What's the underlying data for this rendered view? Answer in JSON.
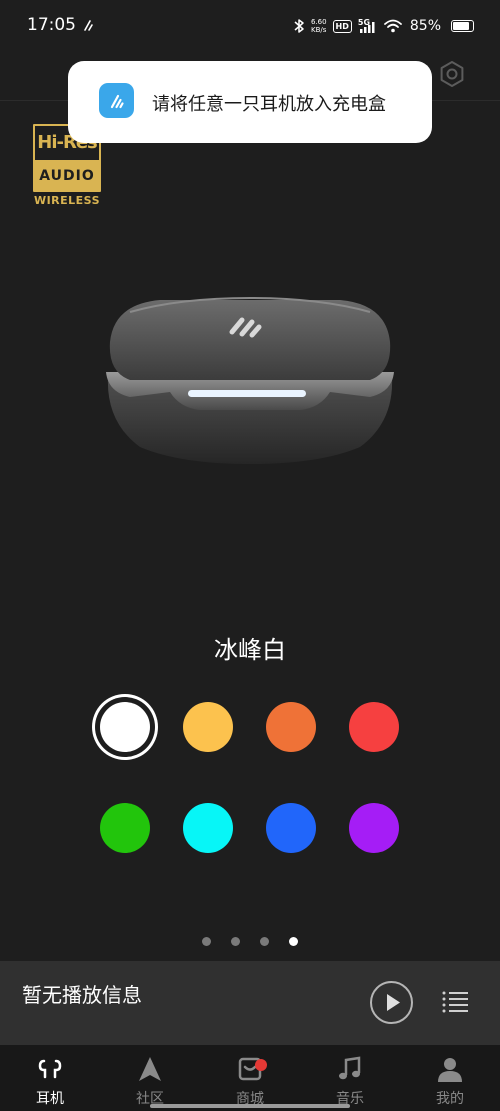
{
  "status_bar": {
    "time": "17:05",
    "speed_value": "6.60",
    "speed_unit": "KB/s",
    "hd_label": "HD",
    "network_label": "5G",
    "battery": "85%",
    "battery_level": 0.85
  },
  "notification": {
    "text": "请将任意一只耳机放入充电盒",
    "icon": "edifier-app-icon"
  },
  "logo": {
    "hires_text": "Hi-Res",
    "audio_text": "AUDIO",
    "wireless_text": "WIRELESS"
  },
  "product": {
    "image": "earbuds-charging-case",
    "color_name": "冰峰白"
  },
  "swatches": [
    {
      "color": "#ffffff",
      "selected": true
    },
    {
      "color": "#fcc24e",
      "selected": false
    },
    {
      "color": "#ef7237",
      "selected": false
    },
    {
      "color": "#f64040",
      "selected": false
    },
    {
      "color": "#22c50c",
      "selected": false
    },
    {
      "color": "#07f6f7",
      "selected": false
    },
    {
      "color": "#2166fa",
      "selected": false
    },
    {
      "color": "#a51df6",
      "selected": false
    }
  ],
  "pager": {
    "total": 4,
    "active_index": 3
  },
  "player": {
    "text": "暂无播放信息"
  },
  "bottom_nav": {
    "items": [
      {
        "label": "耳机",
        "icon": "earbuds-icon",
        "active": true
      },
      {
        "label": "社区",
        "icon": "community-icon",
        "active": false
      },
      {
        "label": "商城",
        "icon": "shop-icon",
        "active": false
      },
      {
        "label": "音乐",
        "icon": "music-icon",
        "active": false
      },
      {
        "label": "我的",
        "icon": "profile-icon",
        "active": false
      }
    ]
  },
  "colors": {
    "background": "#1e1e1e",
    "player_bar": "#303030",
    "nav_bar": "#181818",
    "hires_gold": "#d9b452"
  }
}
